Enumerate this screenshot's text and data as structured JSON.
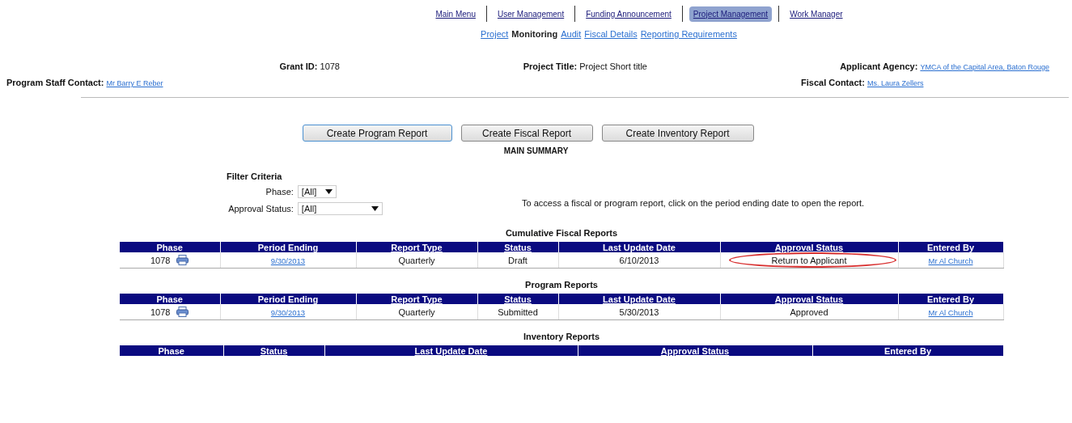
{
  "nav": {
    "tabs": [
      {
        "label": "Main Menu",
        "selected": false
      },
      {
        "label": "User Management",
        "selected": false
      },
      {
        "label": "Funding Announcement",
        "selected": false
      },
      {
        "label": "Project Management",
        "selected": true
      },
      {
        "label": "Work Manager",
        "selected": false
      }
    ],
    "subnav": [
      {
        "label": "Project",
        "selected": false
      },
      {
        "label": "Monitoring",
        "selected": true
      },
      {
        "label": "Audit",
        "selected": false
      },
      {
        "label": "Fiscal Details",
        "selected": false
      },
      {
        "label": "Reporting Requirements",
        "selected": false
      }
    ]
  },
  "info": {
    "grant_id": {
      "label": "Grant ID:",
      "value": "1078"
    },
    "project_title": {
      "label": "Project Title:",
      "value": "Project Short title"
    },
    "applicant_agency": {
      "label": "Applicant Agency:",
      "value": "YMCA of the Capital Area, Baton Rouge"
    },
    "program_staff_contact": {
      "label": "Program Staff Contact:",
      "value": "Mr Barry E Reber"
    },
    "fiscal_contact": {
      "label": "Fiscal Contact:",
      "value": "Ms. Laura Zellers"
    }
  },
  "buttons": [
    {
      "label": "Create Program Report",
      "selected": true
    },
    {
      "label": "Create Fiscal Report",
      "selected": false
    },
    {
      "label": "Create Inventory Report",
      "selected": false
    }
  ],
  "summary_title": "MAIN SUMMARY",
  "filter": {
    "title": "Filter Criteria",
    "fields": [
      {
        "label": "Phase:",
        "value": "[All]"
      },
      {
        "label": "Approval Status:",
        "value": "[All]"
      }
    ]
  },
  "hint": "To access a fiscal or program report, click on the period ending date to open the report.",
  "tables": [
    {
      "title": "Cumulative Fiscal Reports",
      "columns": [
        {
          "label": "Phase",
          "link": false
        },
        {
          "label": "Period Ending",
          "link": false
        },
        {
          "label": "Report Type",
          "link": true
        },
        {
          "label": "Status",
          "link": true
        },
        {
          "label": "Last Update Date",
          "link": false
        },
        {
          "label": "Approval Status",
          "link": true
        },
        {
          "label": "Entered By",
          "link": false
        }
      ],
      "rows": [
        {
          "cells": [
            {
              "kind": "phase",
              "text": "1078",
              "circled": false
            },
            {
              "kind": "link",
              "text": "9/30/2013",
              "circled": false
            },
            {
              "kind": "text",
              "text": "Quarterly",
              "circled": false
            },
            {
              "kind": "text",
              "text": "Draft",
              "circled": false
            },
            {
              "kind": "text",
              "text": "6/10/2013",
              "circled": false
            },
            {
              "kind": "text",
              "text": "Return to Applicant",
              "circled": true
            },
            {
              "kind": "link",
              "text": "Mr Al Church",
              "circled": false
            }
          ]
        }
      ]
    },
    {
      "title": "Program Reports",
      "columns": [
        {
          "label": "Phase",
          "link": false
        },
        {
          "label": "Period Ending",
          "link": false
        },
        {
          "label": "Report Type",
          "link": true
        },
        {
          "label": "Status",
          "link": true
        },
        {
          "label": "Last Update Date",
          "link": true
        },
        {
          "label": "Approval Status",
          "link": true
        },
        {
          "label": "Entered By",
          "link": false
        }
      ],
      "rows": [
        {
          "cells": [
            {
              "kind": "phase",
              "text": "1078",
              "circled": false
            },
            {
              "kind": "link",
              "text": "9/30/2013",
              "circled": false
            },
            {
              "kind": "text",
              "text": "Quarterly",
              "circled": false
            },
            {
              "kind": "text",
              "text": "Submitted",
              "circled": false
            },
            {
              "kind": "text",
              "text": "5/30/2013",
              "circled": false
            },
            {
              "kind": "text",
              "text": "Approved",
              "circled": false
            },
            {
              "kind": "link",
              "text": "Mr Al Church",
              "circled": false
            }
          ]
        }
      ]
    },
    {
      "title": "Inventory Reports",
      "columns": [
        {
          "label": "Phase",
          "link": false
        },
        {
          "label": "Status",
          "link": true
        },
        {
          "label": "Last Update Date",
          "link": true
        },
        {
          "label": "Approval Status",
          "link": true
        },
        {
          "label": "Entered By",
          "link": false
        }
      ]
    }
  ]
}
